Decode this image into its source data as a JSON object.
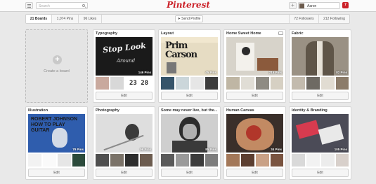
{
  "topbar": {
    "menu_icon": "hamburger-icon",
    "search_placeholder": "Search",
    "logo": "Pinterest",
    "add_icon": "plus-icon",
    "user_name": "Aaron",
    "notifications_count": "7"
  },
  "stats": {
    "boards": "21 Boards",
    "pins": "1,074 Pins",
    "likes": "96 Likes",
    "send_profile": "Send Profile",
    "followers": "72 Followers",
    "following": "212 Following"
  },
  "create_board": {
    "label": "Create a board",
    "icon": "plus-circle-icon"
  },
  "boards": [
    {
      "title": "Typography",
      "pins": "146 Pins",
      "edit": "Edit",
      "cover_text": "Stop Look Around"
    },
    {
      "title": "Layout",
      "pins": "45 Pins",
      "edit": "Edit",
      "cover_text": "Prim Carson"
    },
    {
      "title": "Home Sweet Home",
      "pins": "215 Pins",
      "edit": "Edit"
    },
    {
      "title": "Fabric",
      "pins": "82 Pins",
      "edit": "Edit"
    },
    {
      "title": "Illustration",
      "pins": "79 Pins",
      "edit": "Edit",
      "cover_text": "Robert Johnson How to Play Guitar"
    },
    {
      "title": "Photography",
      "pins": "96 Pins",
      "edit": "Edit"
    },
    {
      "title": "Some may never live, but the...",
      "pins": "85 Pins",
      "edit": "Edit"
    },
    {
      "title": "Human Canvas",
      "pins": "34 Pins",
      "edit": "Edit"
    },
    {
      "title": "Identity & Branding",
      "pins": "105 Pins",
      "edit": "Edit"
    }
  ],
  "typography_thumb_text": "23 28",
  "colors": {
    "brand": "#cb2027",
    "background": "#e9e9e9"
  }
}
